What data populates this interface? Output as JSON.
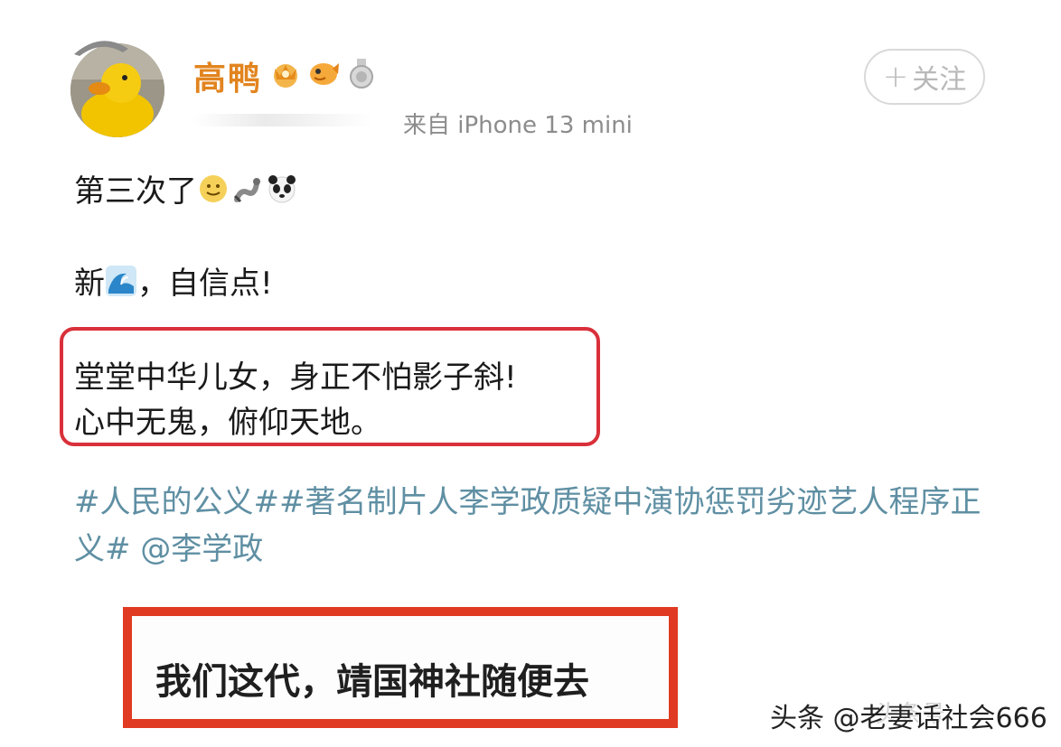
{
  "post": {
    "username": "高鸭",
    "source": "来自 iPhone 13 mini",
    "follow_label": "关注",
    "follow_plus": "+",
    "badges": [
      "crown-badge-icon",
      "fish-badge-icon",
      "silver-medal-icon"
    ],
    "line1_text": "第三次了",
    "line1_emojis": [
      "smile-emoji-icon",
      "snake-emoji-icon",
      "panda-emoji-icon"
    ],
    "line2_prefix": "新",
    "line2_emoji": "wave-emoji-icon",
    "line2_suffix": "，自信点!",
    "quote_line1": "堂堂中华儿女，身正不怕影子斜!",
    "quote_line2": "心中无鬼，俯仰天地。",
    "tags_text": "#人民的公义##著名制片人李学政质疑中演协惩罚劣迹艺人程序正义# @李学政"
  },
  "highlight": {
    "text": "我们这代，靖国神社随便去"
  },
  "watermark": {
    "text": "头条 @老妻话社会666"
  },
  "colors": {
    "username": "#e2841f",
    "tag_link": "#5f8fa3",
    "quote_border": "#d9303a",
    "highlight_border": "#e03b22",
    "source_gray": "#8c8c8c"
  }
}
